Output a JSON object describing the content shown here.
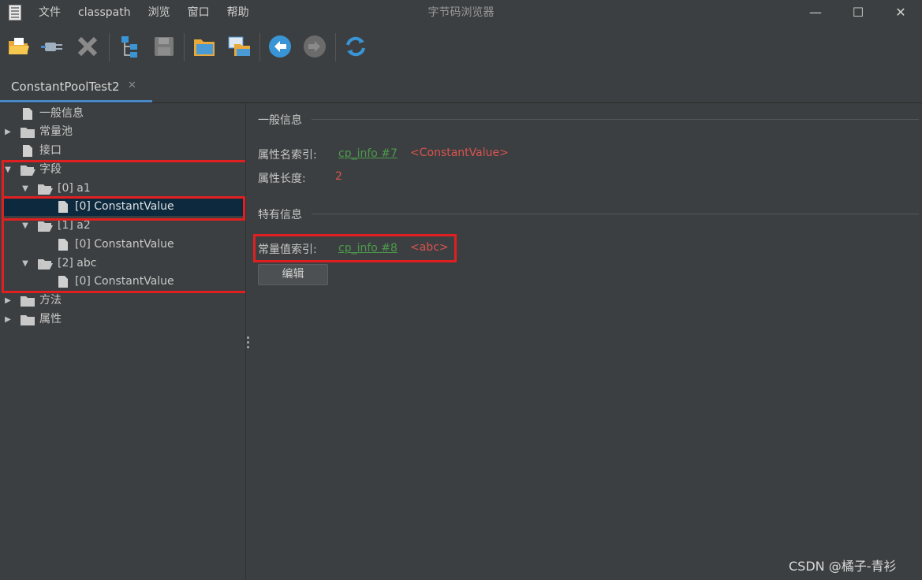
{
  "window": {
    "title": "字节码浏览器",
    "menu": [
      "文件",
      "classpath",
      "浏览",
      "窗口",
      "帮助"
    ],
    "controls": {
      "minimize": "—",
      "maximize": "☐",
      "close": "✕"
    }
  },
  "toolbar": {
    "icons": [
      "open-folder-icon",
      "plug-icon",
      "close-x-icon",
      "tree-structure-icon",
      "save-disk-icon",
      "folder-browse-icon",
      "window-folder-icon",
      "back-arrow-icon",
      "forward-arrow-icon",
      "refresh-icon"
    ]
  },
  "tabs": [
    {
      "label": "ConstantPoolTest2",
      "close": "✕"
    }
  ],
  "tree": {
    "items": [
      {
        "label": "一般信息"
      },
      {
        "label": "常量池",
        "arrow": "▶"
      },
      {
        "label": "接口"
      },
      {
        "label": "字段",
        "arrow": "▼"
      },
      {
        "label": "[0] a1",
        "arrow": "▼"
      },
      {
        "label": "[0] ConstantValue"
      },
      {
        "label": "[1] a2",
        "arrow": "▼"
      },
      {
        "label": "[0] ConstantValue"
      },
      {
        "label": "[2] abc",
        "arrow": "▼"
      },
      {
        "label": "[0] ConstantValue"
      },
      {
        "label": "方法",
        "arrow": "▶"
      },
      {
        "label": "属性",
        "arrow": "▶"
      }
    ]
  },
  "panel": {
    "general_title": "一般信息",
    "attr_name_label": "属性名索引:",
    "attr_name_link": "cp_info #7",
    "attr_name_value": "<ConstantValue>",
    "attr_len_label": "属性长度:",
    "attr_len_value": "2",
    "specific_title": "特有信息",
    "const_label": "常量值索引:",
    "const_link": "cp_info #8",
    "const_value": "<abc>",
    "edit_button": "编辑"
  },
  "watermark": "CSDN @橘子-青衫",
  "colors": {
    "highlight_box": "#e02020",
    "link": "#4c9a4c",
    "value": "#d9534f",
    "selection": "#0d293e"
  }
}
